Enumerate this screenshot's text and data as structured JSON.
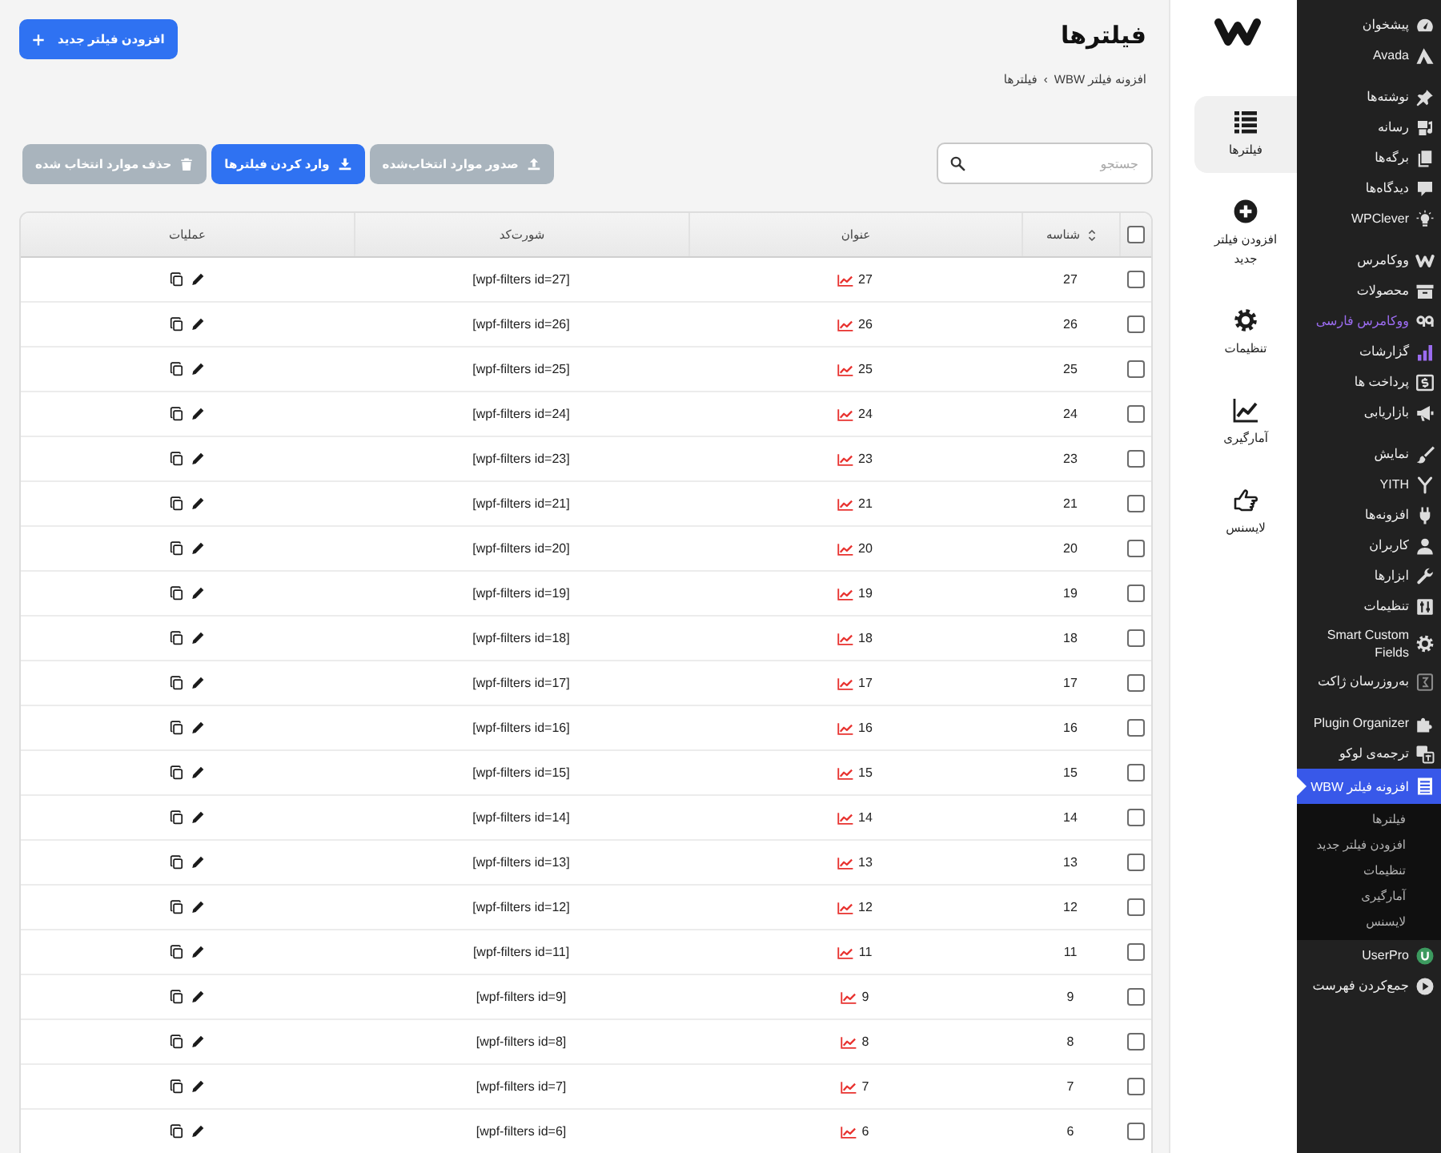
{
  "admin_menu": {
    "groups": [
      [
        {
          "label": "پیشخوان",
          "selected": false
        },
        {
          "label": "Avada",
          "selected": false
        }
      ],
      [
        {
          "label": "نوشته‌ها",
          "selected": false
        },
        {
          "label": "رسانه",
          "selected": false
        },
        {
          "label": "برگه‌ها",
          "selected": false
        },
        {
          "label": "دیدگاه‌ها",
          "selected": false
        },
        {
          "label": "WPClever",
          "selected": false
        }
      ],
      [
        {
          "label": "ووکامرس",
          "selected": false
        },
        {
          "label": "محصولات",
          "selected": false
        },
        {
          "label": "ووکامرس فارسی",
          "selected": false,
          "color": "#9b6cf0"
        },
        {
          "label": "گزارشات",
          "selected": false
        },
        {
          "label": "پرداخت ها",
          "selected": false
        },
        {
          "label": "بازاریابی",
          "selected": false
        }
      ],
      [
        {
          "label": "نمایش",
          "selected": false
        },
        {
          "label": "YITH",
          "selected": false
        },
        {
          "label": "افزونه‌ها",
          "selected": false
        },
        {
          "label": "کاربران",
          "selected": false
        },
        {
          "label": "ابزارها",
          "selected": false
        },
        {
          "label": "تنظیمات",
          "selected": false
        },
        {
          "label": "Smart Custom Fields",
          "selected": false
        },
        {
          "label": "به‌روزرسان ژاکت",
          "selected": false
        }
      ],
      [
        {
          "label": "Plugin Organizer",
          "selected": false
        },
        {
          "label": "ترجمه‌ی لوکو",
          "selected": false
        },
        {
          "label": "افزونه فیلتر WBW",
          "selected": true,
          "children": [
            {
              "label": "فیلترها",
              "selected": false
            },
            {
              "label": "افزودن فیلتر جدید",
              "selected": false
            },
            {
              "label": "تنظیمات",
              "selected": false
            },
            {
              "label": "آمارگیری",
              "selected": false
            },
            {
              "label": "لایسنس",
              "selected": false
            }
          ]
        },
        {
          "label": "UserPro",
          "selected": false
        }
      ]
    ],
    "collapse_label": "جمع‌کردن فهرست"
  },
  "plugin_nav": {
    "items": [
      {
        "label": "فیلترها",
        "selected": true
      },
      {
        "label": "افزودن فیلتر جدید",
        "selected": false
      },
      {
        "label": "تنظیمات",
        "selected": false
      },
      {
        "label": "آمارگیری",
        "selected": false
      },
      {
        "label": "لایسنس",
        "selected": false
      }
    ]
  },
  "page": {
    "title": "فیلترها",
    "breadcrumb": {
      "parent": "افزونه فیلتر WBW",
      "separator": "›",
      "current": "فیلترها"
    },
    "add_button": "افزودن فیلتر جدید"
  },
  "toolbar": {
    "search": {
      "placeholder": "جستجو"
    },
    "buttons": [
      {
        "kind": "export",
        "label": "صدور موارد انتخاب‌شده",
        "disabled": true
      },
      {
        "kind": "import",
        "label": "وارد کردن فیلترها",
        "disabled": false
      },
      {
        "kind": "delete",
        "label": "حذف موارد انتخاب شده",
        "disabled": true
      }
    ]
  },
  "table": {
    "select_all_checked": false,
    "columns": [
      {
        "label": "شناسه",
        "sortable": true
      },
      {
        "label": "عنوان",
        "sortable": false
      },
      {
        "label": "شورت‌کد",
        "sortable": false
      },
      {
        "label": "عملیات",
        "sortable": false
      }
    ],
    "rows": [
      {
        "checked": false,
        "id": "27",
        "title": "27",
        "shortcode": "[wpf-filters id=27]"
      },
      {
        "checked": false,
        "id": "26",
        "title": "26",
        "shortcode": "[wpf-filters id=26]"
      },
      {
        "checked": false,
        "id": "25",
        "title": "25",
        "shortcode": "[wpf-filters id=25]"
      },
      {
        "checked": false,
        "id": "24",
        "title": "24",
        "shortcode": "[wpf-filters id=24]"
      },
      {
        "checked": false,
        "id": "23",
        "title": "23",
        "shortcode": "[wpf-filters id=23]"
      },
      {
        "checked": false,
        "id": "21",
        "title": "21",
        "shortcode": "[wpf-filters id=21]"
      },
      {
        "checked": false,
        "id": "20",
        "title": "20",
        "shortcode": "[wpf-filters id=20]"
      },
      {
        "checked": false,
        "id": "19",
        "title": "19",
        "shortcode": "[wpf-filters id=19]"
      },
      {
        "checked": false,
        "id": "18",
        "title": "18",
        "shortcode": "[wpf-filters id=18]"
      },
      {
        "checked": false,
        "id": "17",
        "title": "17",
        "shortcode": "[wpf-filters id=17]"
      },
      {
        "checked": false,
        "id": "16",
        "title": "16",
        "shortcode": "[wpf-filters id=16]"
      },
      {
        "checked": false,
        "id": "15",
        "title": "15",
        "shortcode": "[wpf-filters id=15]"
      },
      {
        "checked": false,
        "id": "14",
        "title": "14",
        "shortcode": "[wpf-filters id=14]"
      },
      {
        "checked": false,
        "id": "13",
        "title": "13",
        "shortcode": "[wpf-filters id=13]"
      },
      {
        "checked": false,
        "id": "12",
        "title": "12",
        "shortcode": "[wpf-filters id=12]"
      },
      {
        "checked": false,
        "id": "11",
        "title": "11",
        "shortcode": "[wpf-filters id=11]"
      },
      {
        "checked": false,
        "id": "9",
        "title": "9",
        "shortcode": "[wpf-filters id=9]"
      },
      {
        "checked": false,
        "id": "8",
        "title": "8",
        "shortcode": "[wpf-filters id=8]"
      },
      {
        "checked": false,
        "id": "7",
        "title": "7",
        "shortcode": "[wpf-filters id=7]"
      },
      {
        "checked": false,
        "id": "6",
        "title": "6",
        "shortcode": "[wpf-filters id=6]"
      }
    ]
  }
}
